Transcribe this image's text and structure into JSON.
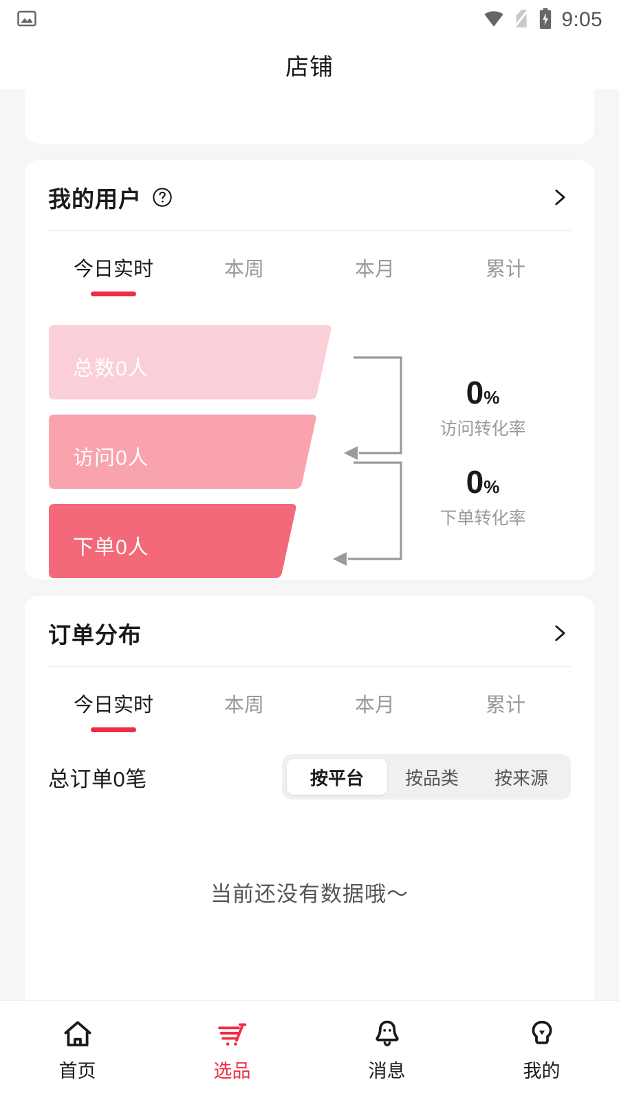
{
  "status_bar": {
    "icons": [
      "image-icon",
      "wifi-icon",
      "no-sim-icon",
      "battery-charging-icon"
    ],
    "time": "9:05"
  },
  "header": {
    "title": "店铺"
  },
  "colors": {
    "accent_red": "#f02c44",
    "funnel_total": "#fbcfd7",
    "funnel_visit": "#f9a3ae",
    "funnel_order": "#f4697a",
    "page_bg": "#f6f6f6",
    "card_bg": "#ffffff"
  },
  "user_card": {
    "title": "我的用户",
    "help_icon": "question-circle-icon",
    "more_icon": "chevron-right-icon",
    "tabs": [
      {
        "label": "今日实时",
        "active": true
      },
      {
        "label": "本周",
        "active": false
      },
      {
        "label": "本月",
        "active": false
      },
      {
        "label": "累计",
        "active": false
      }
    ],
    "funnel": {
      "stages": [
        {
          "label": "总数0人",
          "value": 0,
          "unit": "人",
          "color": "#fbcfd7"
        },
        {
          "label": "访问0人",
          "value": 0,
          "unit": "人",
          "color": "#f9a3ae"
        },
        {
          "label": "下单0人",
          "value": 0,
          "unit": "人",
          "color": "#f4697a"
        }
      ],
      "conversions": [
        {
          "value": "0",
          "percent": "%",
          "caption": "访问转化率"
        },
        {
          "value": "0",
          "percent": "%",
          "caption": "下单转化率"
        }
      ]
    }
  },
  "order_card": {
    "title": "订单分布",
    "more_icon": "chevron-right-icon",
    "tabs": [
      {
        "label": "今日实时",
        "active": true
      },
      {
        "label": "本周",
        "active": false
      },
      {
        "label": "本月",
        "active": false
      },
      {
        "label": "累计",
        "active": false
      }
    ],
    "summary": "总订单0笔",
    "segments": [
      {
        "label": "按平台",
        "active": true
      },
      {
        "label": "按品类",
        "active": false
      },
      {
        "label": "按来源",
        "active": false
      }
    ],
    "empty_text": "当前还没有数据哦～"
  },
  "bottom_nav": [
    {
      "label": "首页",
      "icon": "home-icon",
      "active": false
    },
    {
      "label": "选品",
      "icon": "shopping-cart-icon",
      "active": true
    },
    {
      "label": "消息",
      "icon": "bell-icon",
      "active": false
    },
    {
      "label": "我的",
      "icon": "person-icon",
      "active": false
    }
  ],
  "chart_data": {
    "type": "funnel",
    "title": "我的用户",
    "period": "今日实时",
    "categories": [
      "总数",
      "访问",
      "下单"
    ],
    "values": [
      0,
      0,
      0
    ],
    "unit": "人",
    "conversion_rates": [
      {
        "name": "访问转化率",
        "value": 0,
        "unit": "%"
      },
      {
        "name": "下单转化率",
        "value": 0,
        "unit": "%"
      }
    ],
    "secondary": {
      "type": "table",
      "title": "订单分布",
      "period": "今日实时",
      "group_by": "按平台",
      "total_label": "总订单0笔",
      "total": 0,
      "rows": [],
      "empty_message": "当前还没有数据哦～"
    }
  }
}
